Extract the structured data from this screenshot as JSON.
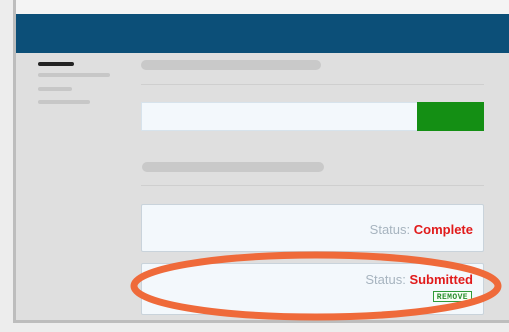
{
  "cards": [
    {
      "status_label": "Status:",
      "status_value": "Complete"
    },
    {
      "status_label": "Status:",
      "status_value": "Submitted",
      "action_label": "REMOVE"
    }
  ],
  "colors": {
    "header": "#0c4f78",
    "action_button": "#148f14",
    "status_value": "#e11b1b",
    "remove_tag": "#2f9b39",
    "highlight_oval": "#ef6a3a"
  }
}
